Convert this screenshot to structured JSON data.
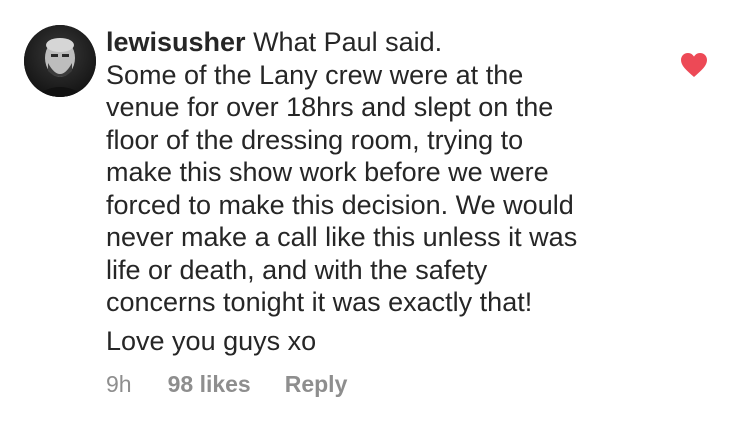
{
  "comment": {
    "username": "lewisusher",
    "first_line": "What Paul said.",
    "paragraph": "Some of the Lany crew were at the\nvenue for over 18hrs and slept on the\nfloor of the dressing room, trying to\nmake this show work before we were\nforced to make this decision. We would\nnever make a call like this unless it was\nlife or death, and with the safety\nconcerns tonight it was exactly that!",
    "signoff": "Love you guys xo",
    "time": "9h",
    "likes": "98 likes",
    "reply_label": "Reply",
    "liked": true,
    "heart_icon": "heart-icon",
    "heart_color": "#ed4956"
  }
}
